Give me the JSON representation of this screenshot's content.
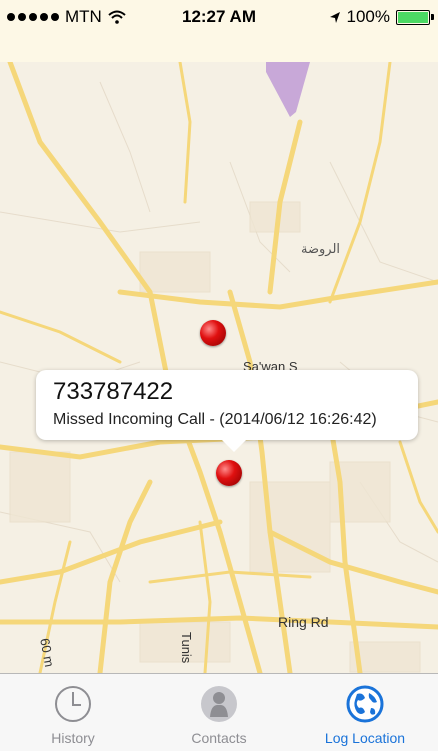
{
  "status": {
    "carrier": "MTN",
    "time": "12:27 AM",
    "battery": "100%"
  },
  "map": {
    "labels": {
      "arabic_district": "الروضة",
      "sawan": "Sa'wan S",
      "ring_rd": "Ring Rd",
      "tunis": "Tunis",
      "sixty": "60 m"
    }
  },
  "callout": {
    "phone": "733787422",
    "detail": "Missed Incoming Call - (2014/06/12 16:26:42)"
  },
  "tabs": [
    {
      "label": "History",
      "icon": "clock-icon",
      "active": false
    },
    {
      "label": "Contacts",
      "icon": "person-icon",
      "active": false
    },
    {
      "label": "Log Location",
      "icon": "globe-icon",
      "active": true
    }
  ],
  "colors": {
    "accent": "#1a73d9",
    "road": "#f5d77a",
    "pin": "#e01010",
    "park": "#c8a8d8"
  }
}
